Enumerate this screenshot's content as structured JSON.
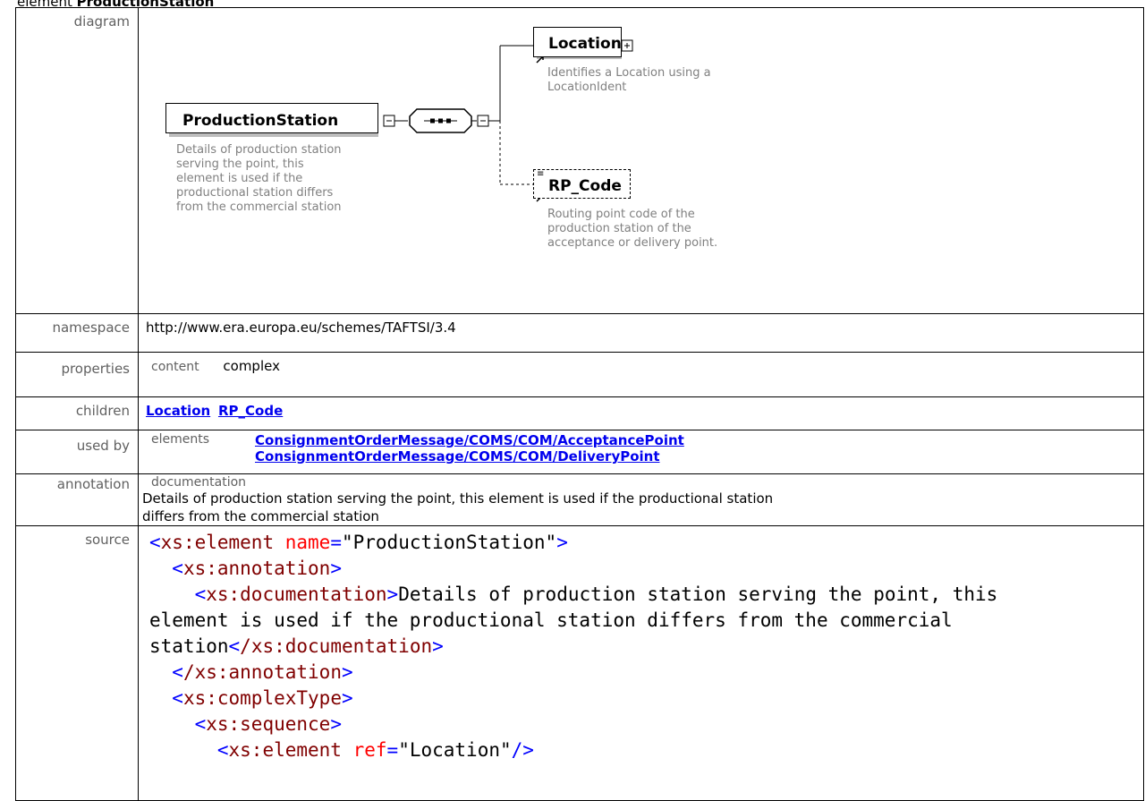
{
  "page": {
    "heading_prefix": "element",
    "heading_name": "ProductionStation"
  },
  "rows": {
    "diagram": "diagram",
    "namespace": "namespace",
    "properties": "properties",
    "children": "children",
    "used_by": "used by",
    "annotation": "annotation",
    "source": "source"
  },
  "diagram": {
    "root": "ProductionStation",
    "root_desc": [
      "Details of production station",
      "serving the point, this",
      "element is used if the",
      "productional station differs",
      "from the commercial station"
    ],
    "child1": "Location",
    "child1_desc": [
      "Identifies a Location using a",
      "LocationIdent"
    ],
    "child2": "RP_Code",
    "child2_desc": [
      "Routing point code of the",
      "production station of the",
      "acceptance or delivery point."
    ]
  },
  "namespace": "http://www.era.europa.eu/schemes/TAFTSI/3.4",
  "properties": {
    "key": "content",
    "value": "complex"
  },
  "children": [
    "Location",
    "RP_Code"
  ],
  "used_by": {
    "key": "elements",
    "items": [
      "ConsignmentOrderMessage/COMS/COM/AcceptancePoint",
      "ConsignmentOrderMessage/COMS/COM/DeliveryPoint"
    ]
  },
  "annotation": {
    "key": "documentation",
    "text": "Details of production station serving the point, this element is used if the productional station differs from the commercial station"
  },
  "source": {
    "open_tag": "xs:element",
    "name_attr": "name",
    "name_val": "\"ProductionStation\"",
    "annotation_tag": "xs:annotation",
    "doc_tag": "xs:documentation",
    "doc_text_1": "Details of production station serving the point, this",
    "doc_text_2": "element is used if the productional station differs from the commercial",
    "doc_text_3": "station",
    "close_doc": "/xs:documentation",
    "close_annotation": "/xs:annotation",
    "complex_tag": "xs:complexType",
    "sequence_tag": "xs:sequence",
    "el_tag": "xs:element",
    "ref_attr": "ref",
    "ref_val": "\"Location\""
  }
}
